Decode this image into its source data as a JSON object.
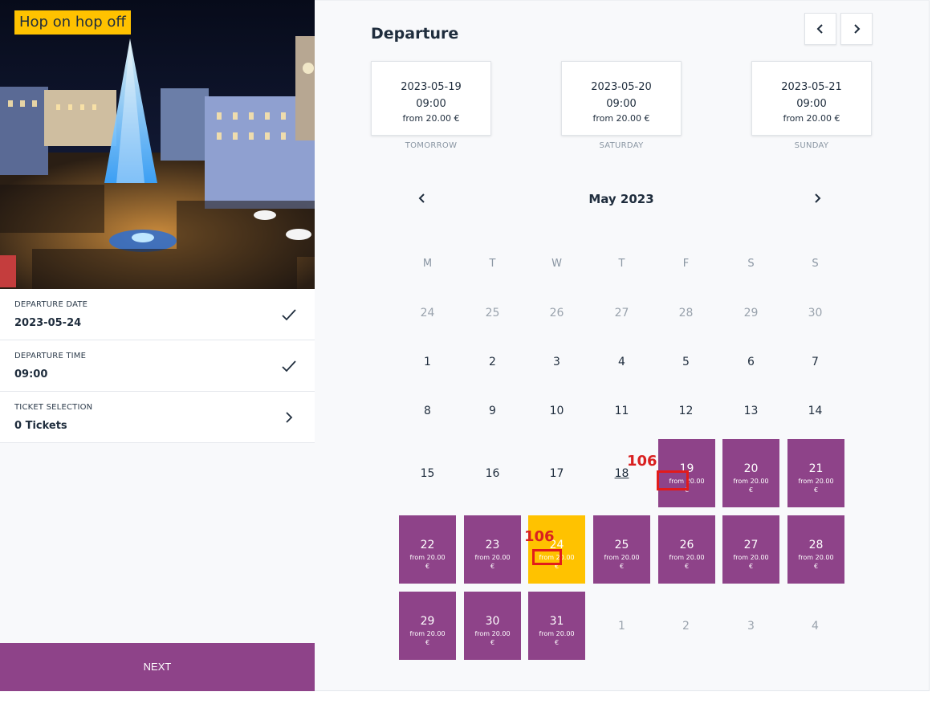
{
  "product": {
    "badge": "Hop on hop off"
  },
  "steps": [
    {
      "label": "DEPARTURE DATE",
      "value": "2023-05-24",
      "icon": "checkmark-icon"
    },
    {
      "label": "DEPARTURE TIME",
      "value": "09:00",
      "icon": "checkmark-icon"
    },
    {
      "label": "TICKET SELECTION",
      "value": "0 Tickets",
      "icon": "chevron-right-icon"
    }
  ],
  "next_label": "NEXT",
  "departure": {
    "title": "Departure",
    "cards": [
      {
        "date": "2023-05-19",
        "time": "09:00",
        "price": "from 20.00 €",
        "caption": "TOMORROW"
      },
      {
        "date": "2023-05-20",
        "time": "09:00",
        "price": "from 20.00 €",
        "caption": "SATURDAY"
      },
      {
        "date": "2023-05-21",
        "time": "09:00",
        "price": "from 20.00 €",
        "caption": "SUNDAY"
      }
    ]
  },
  "calendar": {
    "month": "May 2023",
    "weekdays": [
      "M",
      "T",
      "W",
      "T",
      "F",
      "S",
      "S"
    ],
    "row1": [
      "24",
      "25",
      "26",
      "27",
      "28",
      "29",
      "30"
    ],
    "row2": [
      "1",
      "2",
      "3",
      "4",
      "5",
      "6",
      "7"
    ],
    "row3": [
      "8",
      "9",
      "10",
      "11",
      "12",
      "13",
      "14"
    ],
    "row4_plain": [
      "15",
      "16",
      "17",
      "18"
    ],
    "row4_avail": [
      "19",
      "20",
      "21"
    ],
    "row5": [
      "22",
      "23",
      "24",
      "25",
      "26",
      "27",
      "28"
    ],
    "row6_avail": [
      "29",
      "30",
      "31"
    ],
    "row6_plain": [
      "1",
      "2",
      "3",
      "4"
    ],
    "price_text": "from 20.00",
    "currency": "€",
    "selected": "24"
  },
  "annotations": [
    {
      "label": "106"
    },
    {
      "label": "106"
    }
  ],
  "colors": {
    "accent": "#8e4389",
    "selected": "#ffc200",
    "text": "#1f2d3d",
    "muted": "#9aa3ad",
    "annotation": "#e21b1b"
  }
}
